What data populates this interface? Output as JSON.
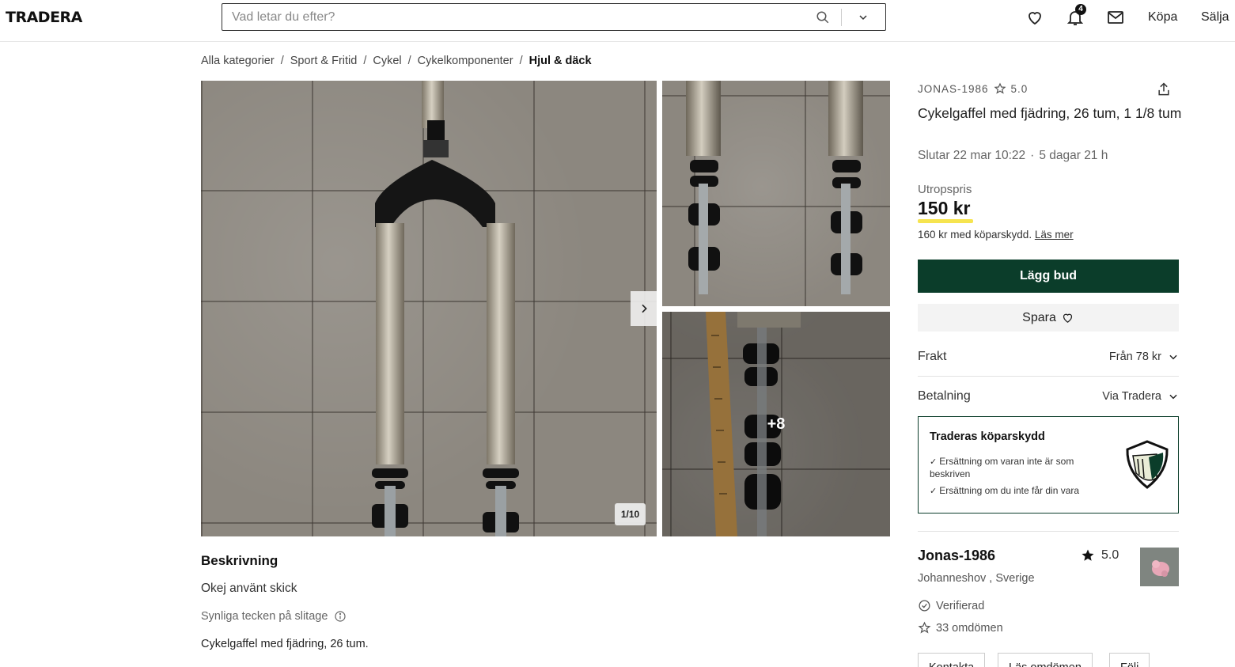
{
  "header": {
    "logo": "TRADERA",
    "search_placeholder": "Vad letar du efter?",
    "notification_count": "4",
    "buy": "Köpa",
    "sell": "Sälja"
  },
  "breadcrumb": [
    "Alla kategorier",
    "Sport & Fritid",
    "Cykel",
    "Cykelkomponenter",
    "Hjul & däck"
  ],
  "gallery": {
    "counter": "1/10",
    "more": "+8"
  },
  "description": {
    "title": "Beskrivning",
    "condition": "Okej använt skick",
    "wear": "Synliga tecken på slitage",
    "text": "Cykelgaffel med fjädring, 26 tum."
  },
  "item": {
    "seller_tag": "JONAS-1986",
    "seller_tag_rating": "5.0",
    "title": "Cykelgaffel med fjädring, 26 tum, 1 1/8 tum",
    "ends": "Slutar 22 mar 10:22",
    "time_left": "5 dagar 21 h",
    "price_label": "Utropspris",
    "price": "150 kr",
    "protect_price": "160 kr med köparskydd.",
    "read_more": "Läs mer",
    "bid_label": "Lägg bud",
    "save_label": "Spara"
  },
  "shipping": {
    "label": "Frakt",
    "value": "Från 78 kr"
  },
  "payment": {
    "label": "Betalning",
    "value": "Via Tradera"
  },
  "protection": {
    "title": "Traderas köparskydd",
    "items": [
      "Ersättning om varan inte är som beskriven",
      "Ersättning om du inte får din vara"
    ]
  },
  "seller": {
    "name": "Jonas-1986",
    "rating": "5.0",
    "location": "Johanneshov , Sverige",
    "verified": "Verifierad",
    "reviews": "33 omdömen",
    "buttons": [
      "Kontakta",
      "Läs omdömen",
      "Följ"
    ]
  },
  "colors": {
    "primary": "#0b3d2a",
    "highlight": "#f6e44f"
  }
}
